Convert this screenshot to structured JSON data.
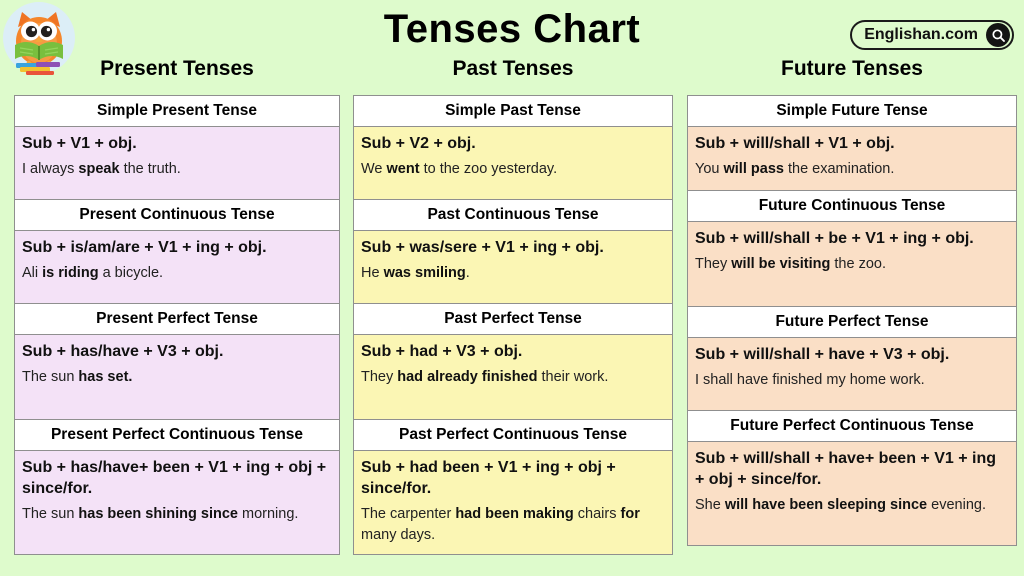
{
  "header": {
    "title": "Tenses Chart",
    "logo_icon": "owl-reading-book-logo",
    "brand": {
      "label": "Englishan.com",
      "icon": "search-icon"
    }
  },
  "colors": {
    "background": "#defbcc",
    "present_cell": "#f4e2f7",
    "past_cell": "#fbf6b4",
    "future_cell": "#fadfc6",
    "header_cell": "#ffffff",
    "border": "#8f8f8f"
  },
  "columns": [
    {
      "heading": "Present Tenses",
      "rows": [
        {
          "title": "Simple Present Tense",
          "formula": "Sub + V1 + obj.",
          "example_prefix": "I always ",
          "example_bold": "speak",
          "example_suffix": " the truth."
        },
        {
          "title": "Present Continuous Tense",
          "formula": "Sub + is/am/are + V1 + ing + obj.",
          "example_prefix": "Ali ",
          "example_bold": "is riding",
          "example_suffix": " a bicycle."
        },
        {
          "title": "Present Perfect Tense",
          "formula": "Sub + has/have + V3 + obj.",
          "example_prefix": "The sun ",
          "example_bold": "has set.",
          "example_suffix": ""
        },
        {
          "title": "Present Perfect Continuous Tense",
          "formula": "Sub + has/have+ been + V1 + ing + obj + since/for.",
          "example_prefix": "The sun ",
          "example_bold": "has been shining since",
          "example_suffix": " morning."
        }
      ]
    },
    {
      "heading": "Past Tenses",
      "rows": [
        {
          "title": "Simple Past Tense",
          "formula": "Sub + V2 + obj.",
          "example_prefix": "We ",
          "example_bold": "went",
          "example_suffix": " to the zoo yesterday."
        },
        {
          "title": "Past Continuous Tense",
          "formula": "Sub + was/sere + V1 + ing + obj.",
          "example_prefix": "He ",
          "example_bold": "was smiling",
          "example_suffix": "."
        },
        {
          "title": "Past Perfect Tense",
          "formula": "Sub + had + V3 + obj.",
          "example_prefix": "They ",
          "example_bold": "had already finished",
          "example_suffix": " their work."
        },
        {
          "title": "Past Perfect Continuous Tense",
          "formula": "Sub + had been + V1 + ing + obj + since/for.",
          "example_prefix": "The carpenter ",
          "example_bold": "had been making",
          "example_suffix": " chairs <b>for</b> many days."
        }
      ]
    },
    {
      "heading": "Future Tenses",
      "rows": [
        {
          "title": "Simple Future Tense",
          "formula": "Sub + will/shall + V1 + obj.",
          "example_prefix": "You ",
          "example_bold": "will pass",
          "example_suffix": " the examination."
        },
        {
          "title": "Future Continuous Tense",
          "formula": "Sub + will/shall + be + V1 + ing + obj.",
          "example_prefix": "They ",
          "example_bold": "will be visiting",
          "example_suffix": " the zoo."
        },
        {
          "title": "Future Perfect Tense",
          "formula": "Sub + will/shall + have + V3 + obj.",
          "example_prefix": "I shall have finished my home work.",
          "example_bold": "",
          "example_suffix": ""
        },
        {
          "title": "Future Perfect Continuous Tense",
          "formula": "Sub + will/shall + have+ been + V1 + ing + obj + since/for.",
          "example_prefix": "She ",
          "example_bold": "will have been sleeping since",
          "example_suffix": " evening."
        }
      ]
    }
  ]
}
